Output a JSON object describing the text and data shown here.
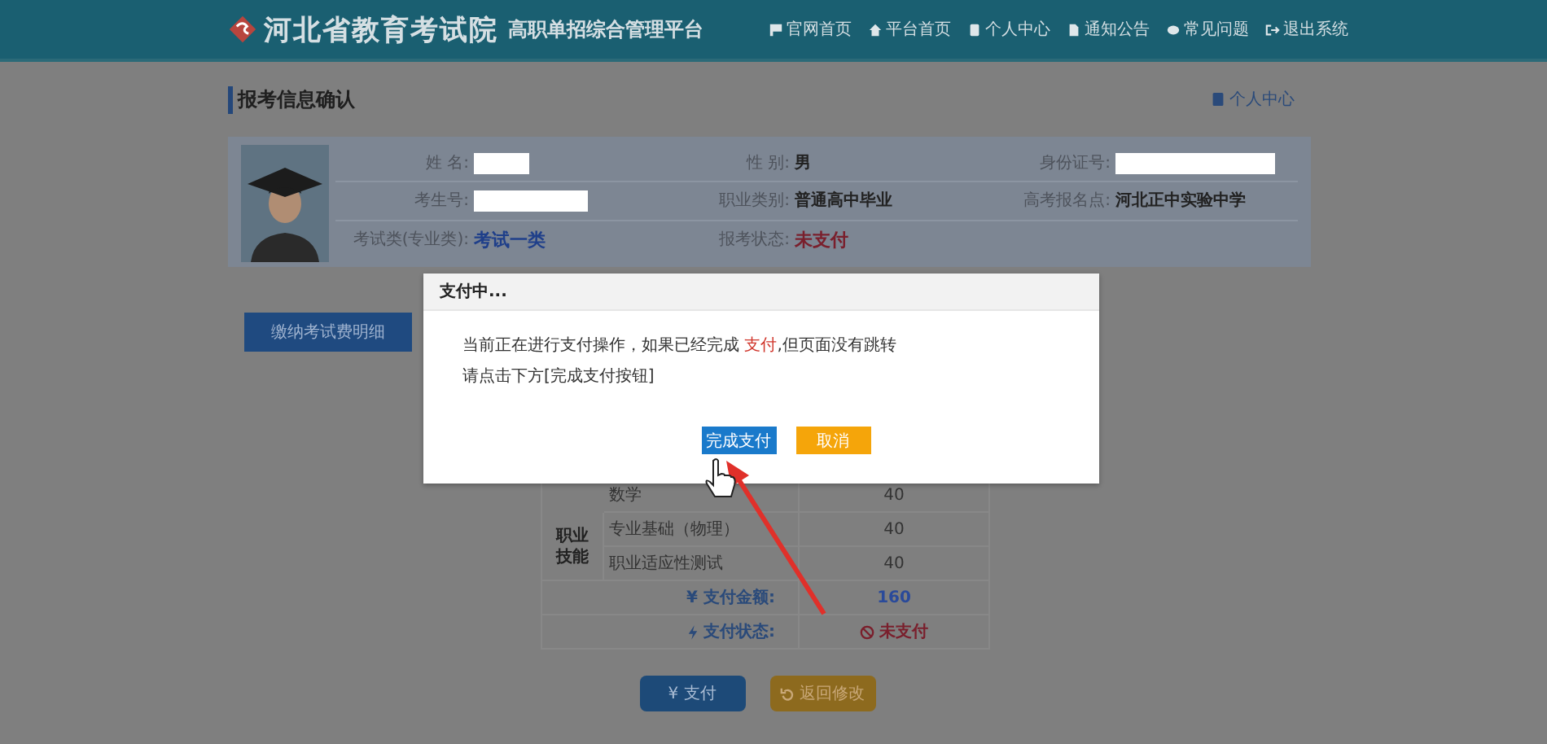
{
  "header": {
    "logo_title": "河北省教育考试院",
    "subtitle": "高职单招综合管理平台",
    "nav": [
      {
        "label": "官网首页"
      },
      {
        "label": "平台首页"
      },
      {
        "label": "个人中心"
      },
      {
        "label": "通知公告"
      },
      {
        "label": "常见问题"
      },
      {
        "label": "退出系统"
      }
    ]
  },
  "page_title": "报考信息确认",
  "personal_center_link": "个人中心",
  "profile": {
    "fields": [
      {
        "label": "姓 名:",
        "kind": "redacted"
      },
      {
        "label": "性 别:",
        "kind": "text",
        "value": "男"
      },
      {
        "label": "身份证号:",
        "kind": "redacted"
      },
      {
        "label": "考生号:",
        "kind": "redacted"
      },
      {
        "label": "职业类别:",
        "kind": "text",
        "value": "普通高中毕业"
      },
      {
        "label": "高考报名点:",
        "kind": "text",
        "value": "河北正中实验中学"
      },
      {
        "label": "考试类(专业类):",
        "kind": "highlight",
        "value": "考试一类"
      },
      {
        "label": "报考状态:",
        "kind": "warning",
        "value": "未支付"
      }
    ]
  },
  "fee_detail_button": "缴纳考试费明细",
  "fee_table": {
    "rows": [
      {
        "name": "数学",
        "amount": "40"
      },
      {
        "group": "职业技能",
        "name": "专业基础（物理）",
        "amount": "40"
      },
      {
        "name": "职业适应性测试",
        "amount": "40"
      }
    ],
    "summary": [
      {
        "label": "¥ 支付金额:",
        "kind": "highlight",
        "value": "160"
      },
      {
        "label": "支付状态:",
        "kind": "warning",
        "value": "未支付"
      }
    ]
  },
  "bottom_buttons": [
    {
      "label": "¥ 支付",
      "kind": "primary"
    },
    {
      "label": "返回修改",
      "kind": "secondary"
    }
  ],
  "dialog": {
    "title": "支付中...",
    "message": [
      {
        "text": "当前正在进行支付操作，如果已经完成 ",
        "highlight": false
      },
      {
        "text": "支付",
        "highlight": true
      },
      {
        "text": ",但页面没有跳转",
        "highlight": false
      }
    ],
    "message_line2": "请点击下方[完成支付按钮]",
    "buttons": [
      {
        "label": "完成支付",
        "kind": "primary"
      },
      {
        "label": "取消",
        "kind": "secondary"
      }
    ]
  }
}
